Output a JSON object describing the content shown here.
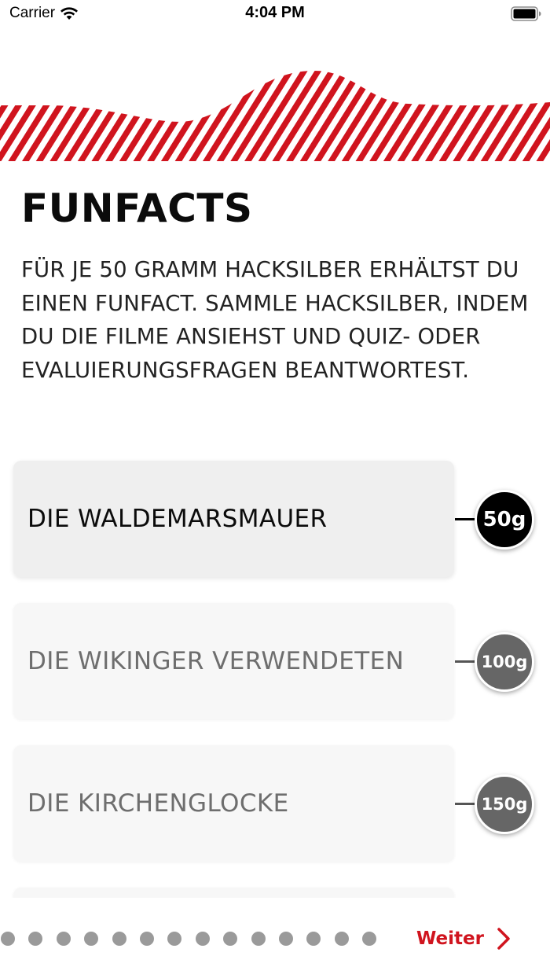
{
  "status_bar": {
    "carrier": "Carrier",
    "time": "4:04 PM"
  },
  "icons": {
    "wifi": "wifi-icon",
    "battery": "battery-icon",
    "next": "chevron-right-icon"
  },
  "colors": {
    "accent": "#d0141e",
    "badge_active": "#000000",
    "badge_locked": "#666666",
    "card_background": "#f7f7f7"
  },
  "page": {
    "title": "FUNFACTS",
    "intro": "FÜR JE 50 GRAMM HACKSILBER ERHÄLTST DU EINEN FUNFACT. SAMMLE HACKSILBER, INDEM DU DIE FILME ANSIEHST UND QUIZ- ODER EVALUIERUNGSFRAGEN BEANTWORTEST."
  },
  "facts": [
    {
      "title": "DIE WALDEMARSMAUER",
      "weight": "50g",
      "unlocked": true
    },
    {
      "title": "DIE WIKINGER VERWENDETEN",
      "weight": "100g",
      "unlocked": false
    },
    {
      "title": "DIE KIRCHENGLOCKE",
      "weight": "150g",
      "unlocked": false
    }
  ],
  "pager": {
    "page_count": 14,
    "next_label": "Weiter"
  }
}
